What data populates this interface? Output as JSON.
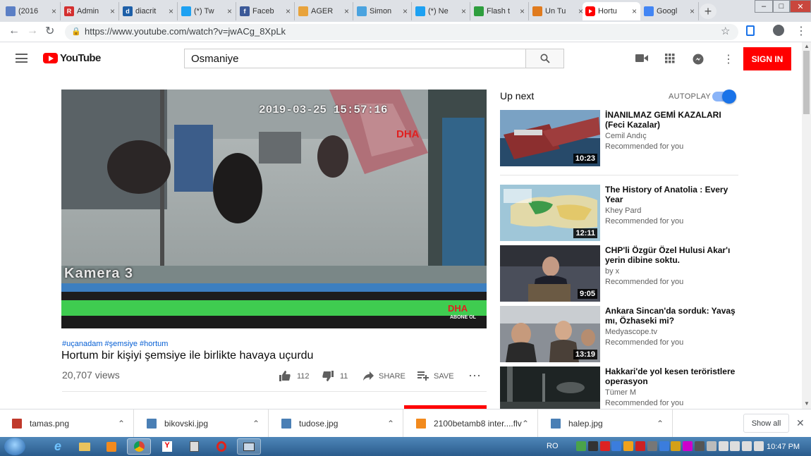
{
  "browser": {
    "tabs": [
      {
        "label": "(2016",
        "fav": "chrome-icon",
        "color": "#5b7fc5"
      },
      {
        "label": "Admin",
        "fav": "R",
        "color": "#d32f2f"
      },
      {
        "label": "diacrit",
        "fav": "d",
        "color": "#1d5fa8"
      },
      {
        "label": "(*) Tw",
        "fav": "twitter-icon",
        "color": "#1da1f2"
      },
      {
        "label": "Faceb",
        "fav": "f",
        "color": "#3b5998"
      },
      {
        "label": "AGER",
        "fav": "translate-icon",
        "color": "#e8a33c"
      },
      {
        "label": "Simon",
        "fav": "bird-icon",
        "color": "#4aa3df"
      },
      {
        "label": "(*) Ne",
        "fav": "twitter-icon",
        "color": "#1da1f2"
      },
      {
        "label": "Flash t",
        "fav": "flash-icon",
        "color": "#2e9e3e"
      },
      {
        "label": "Un Tu",
        "fav": "pin-icon",
        "color": "#e07b1e"
      },
      {
        "label": "Hortu",
        "fav": "youtube-icon",
        "color": "#ff0000",
        "active": true
      },
      {
        "label": "Googl",
        "fav": "translate-icon",
        "color": "#4285f4"
      }
    ],
    "url": "https://www.youtube.com/watch?v=jwACg_8XpLk"
  },
  "youtube": {
    "logo_text": "YouTube",
    "search_value": "Osmaniye",
    "sign_in": "SIGN IN",
    "video": {
      "overlay_timestamp": "2019-03-25 15:57:16",
      "overlay_camera": "Kamera 3",
      "overlay_brand": "DHA",
      "overlay_sub": "ABONE OL",
      "hashtags": "#uçanadam #şemsiye #hortum",
      "title": "Hortum bir kişiyi şemsiye ile birlikte havaya uçurdu",
      "views": "20,707 views",
      "likes": "112",
      "dislikes": "11",
      "share": "SHARE",
      "save": "SAVE"
    },
    "up_next": "Up next",
    "autoplay": "AUTOPLAY",
    "autoplay_on": true,
    "recommendations": [
      {
        "title": "İNANILMAZ GEMİ KAZALARI (Feci Kazalar)",
        "channel": "Cemil Andıç",
        "meta": "Recommended for you",
        "duration": "10:23",
        "thumb": "#2a4c6b"
      },
      {
        "title": "The History of Anatolia : Every Year",
        "channel": "Khey Pard",
        "meta": "Recommended for you",
        "duration": "12:11",
        "thumb": "#8fb6c9"
      },
      {
        "title": "CHP'li Özgür Özel Hulusi Akar'ı yerin dibine soktu.",
        "channel": "by x",
        "meta": "Recommended for you",
        "duration": "9:05",
        "thumb": "#3a3d47"
      },
      {
        "title": "Ankara Sincan'da sorduk: Yavaş mı, Özhaseki mi?",
        "channel": "Medyascope.tv",
        "meta": "Recommended for you",
        "duration": "13:19",
        "thumb": "#6d6258"
      },
      {
        "title": "Hakkari'de yol kesen teröristlere operasyon",
        "channel": "Tümer M",
        "meta": "Recommended for you",
        "duration": "",
        "thumb": "#222a2a"
      }
    ]
  },
  "downloads": {
    "items": [
      {
        "name": "tamas.png"
      },
      {
        "name": "bikovski.jpg"
      },
      {
        "name": "tudose.jpg"
      },
      {
        "name": "2100betamb8 inter....flv"
      },
      {
        "name": "halep.jpg"
      }
    ],
    "show_all": "Show all"
  },
  "taskbar": {
    "lang": "RO",
    "time": "10:47 PM"
  }
}
